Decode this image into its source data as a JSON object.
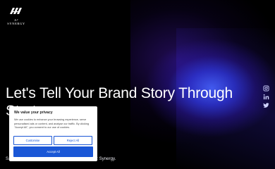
{
  "brand": {
    "logo_text": "A² SYNERGY"
  },
  "hero": {
    "title": "Let's Tell Your Brand Story Through Strategy ...",
    "subtitle": "Say goodbye to boring and hello to bold with A2 Synergy."
  },
  "social": {
    "items": [
      {
        "icon": "instagram-icon"
      },
      {
        "icon": "linkedin-icon"
      },
      {
        "icon": "twitter-icon"
      }
    ]
  },
  "cookie_banner": {
    "title": "We value your privacy",
    "body": "We use cookies to enhance your browsing experience, serve personalised ads or content, and analyse our traffic. By clicking \"Accept All\", you consent to our use of cookies.",
    "customize_label": "Customise",
    "reject_label": "Reject All",
    "accept_label": "Accept All"
  },
  "colors": {
    "accent": "#1a57d6",
    "background": "#000000",
    "glow": "#466eff"
  }
}
